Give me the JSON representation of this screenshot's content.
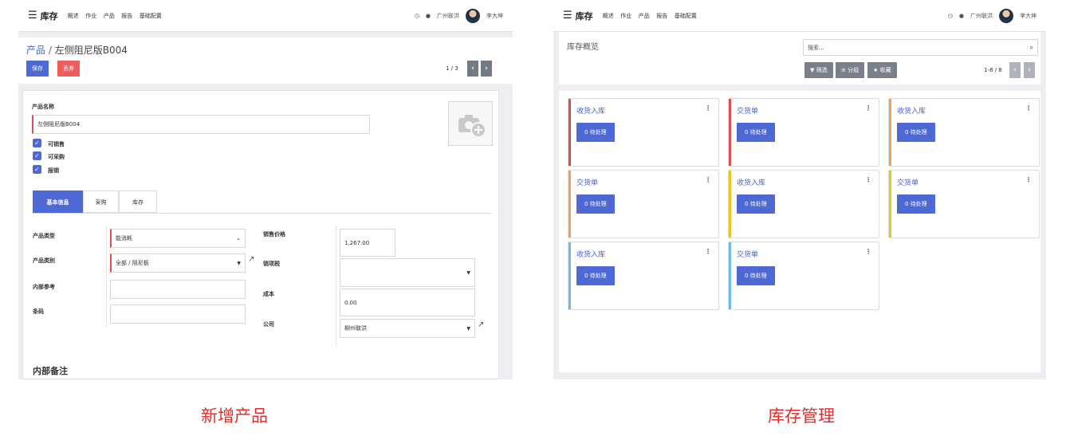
{
  "topbar": {
    "app": "库存",
    "nav": [
      "概述",
      "作业",
      "产品",
      "报告",
      "基础配置"
    ],
    "company": "广州联洪",
    "user": "李大坤"
  },
  "left": {
    "breadcrumb_root": "产品",
    "breadcrumb_sep": "/",
    "breadcrumb_current": "左侧阻尼版B004",
    "save_label": "保存",
    "discard_label": "丢弃",
    "pager": "1 / 3",
    "product_name_label": "产品名称",
    "product_name_value": "左侧阻尼版B004",
    "checkboxes": [
      "可销售",
      "可采购",
      "报销"
    ],
    "tabs": [
      "基本信息",
      "采购",
      "库存"
    ],
    "fields": {
      "product_type_label": "产品类型",
      "product_type_value": "能消耗",
      "product_category_label": "产品类别",
      "product_category_value": "全部 / 阻尼板",
      "internal_ref_label": "内部参考",
      "barcode_label": "条码",
      "sale_price_label": "销售价格",
      "sale_price_value": "1,267.00",
      "sale_tax_label": "销项税",
      "cost_label": "成本",
      "cost_value": "0.00",
      "company_label": "公司",
      "company_value": "柳州联洪"
    },
    "notes_title": "内部备注"
  },
  "right": {
    "title": "库存概览",
    "search_placeholder": "搜索...",
    "filter_label": "筛选",
    "group_label": "分组",
    "favorite_label": "收藏",
    "pager": "1-8 / 8",
    "cards": [
      {
        "title": "收货入库",
        "button": "0 待处理",
        "color": "#e05050"
      },
      {
        "title": "交货单",
        "button": "0 待处理",
        "color": "#e05050"
      },
      {
        "title": "收货入库",
        "button": "0 待处理",
        "color": "#f0a35e"
      },
      {
        "title": "交货单",
        "button": "0 待处理",
        "color": "#f0a35e"
      },
      {
        "title": "收货入库",
        "button": "0 待处理",
        "color": "#f0c419"
      },
      {
        "title": "交货单",
        "button": "0 待处理",
        "color": "#f0c419"
      },
      {
        "title": "收货入库",
        "button": "0 待处理",
        "color": "#6cbde6"
      },
      {
        "title": "交货单",
        "button": "0 待处理",
        "color": "#6cbde6"
      }
    ]
  },
  "captions": {
    "left": "新增产品",
    "right": "库存管理"
  },
  "colors": {
    "primary": "#4e69d6",
    "danger": "#ee5c5c",
    "caption": "#e22d2d"
  }
}
